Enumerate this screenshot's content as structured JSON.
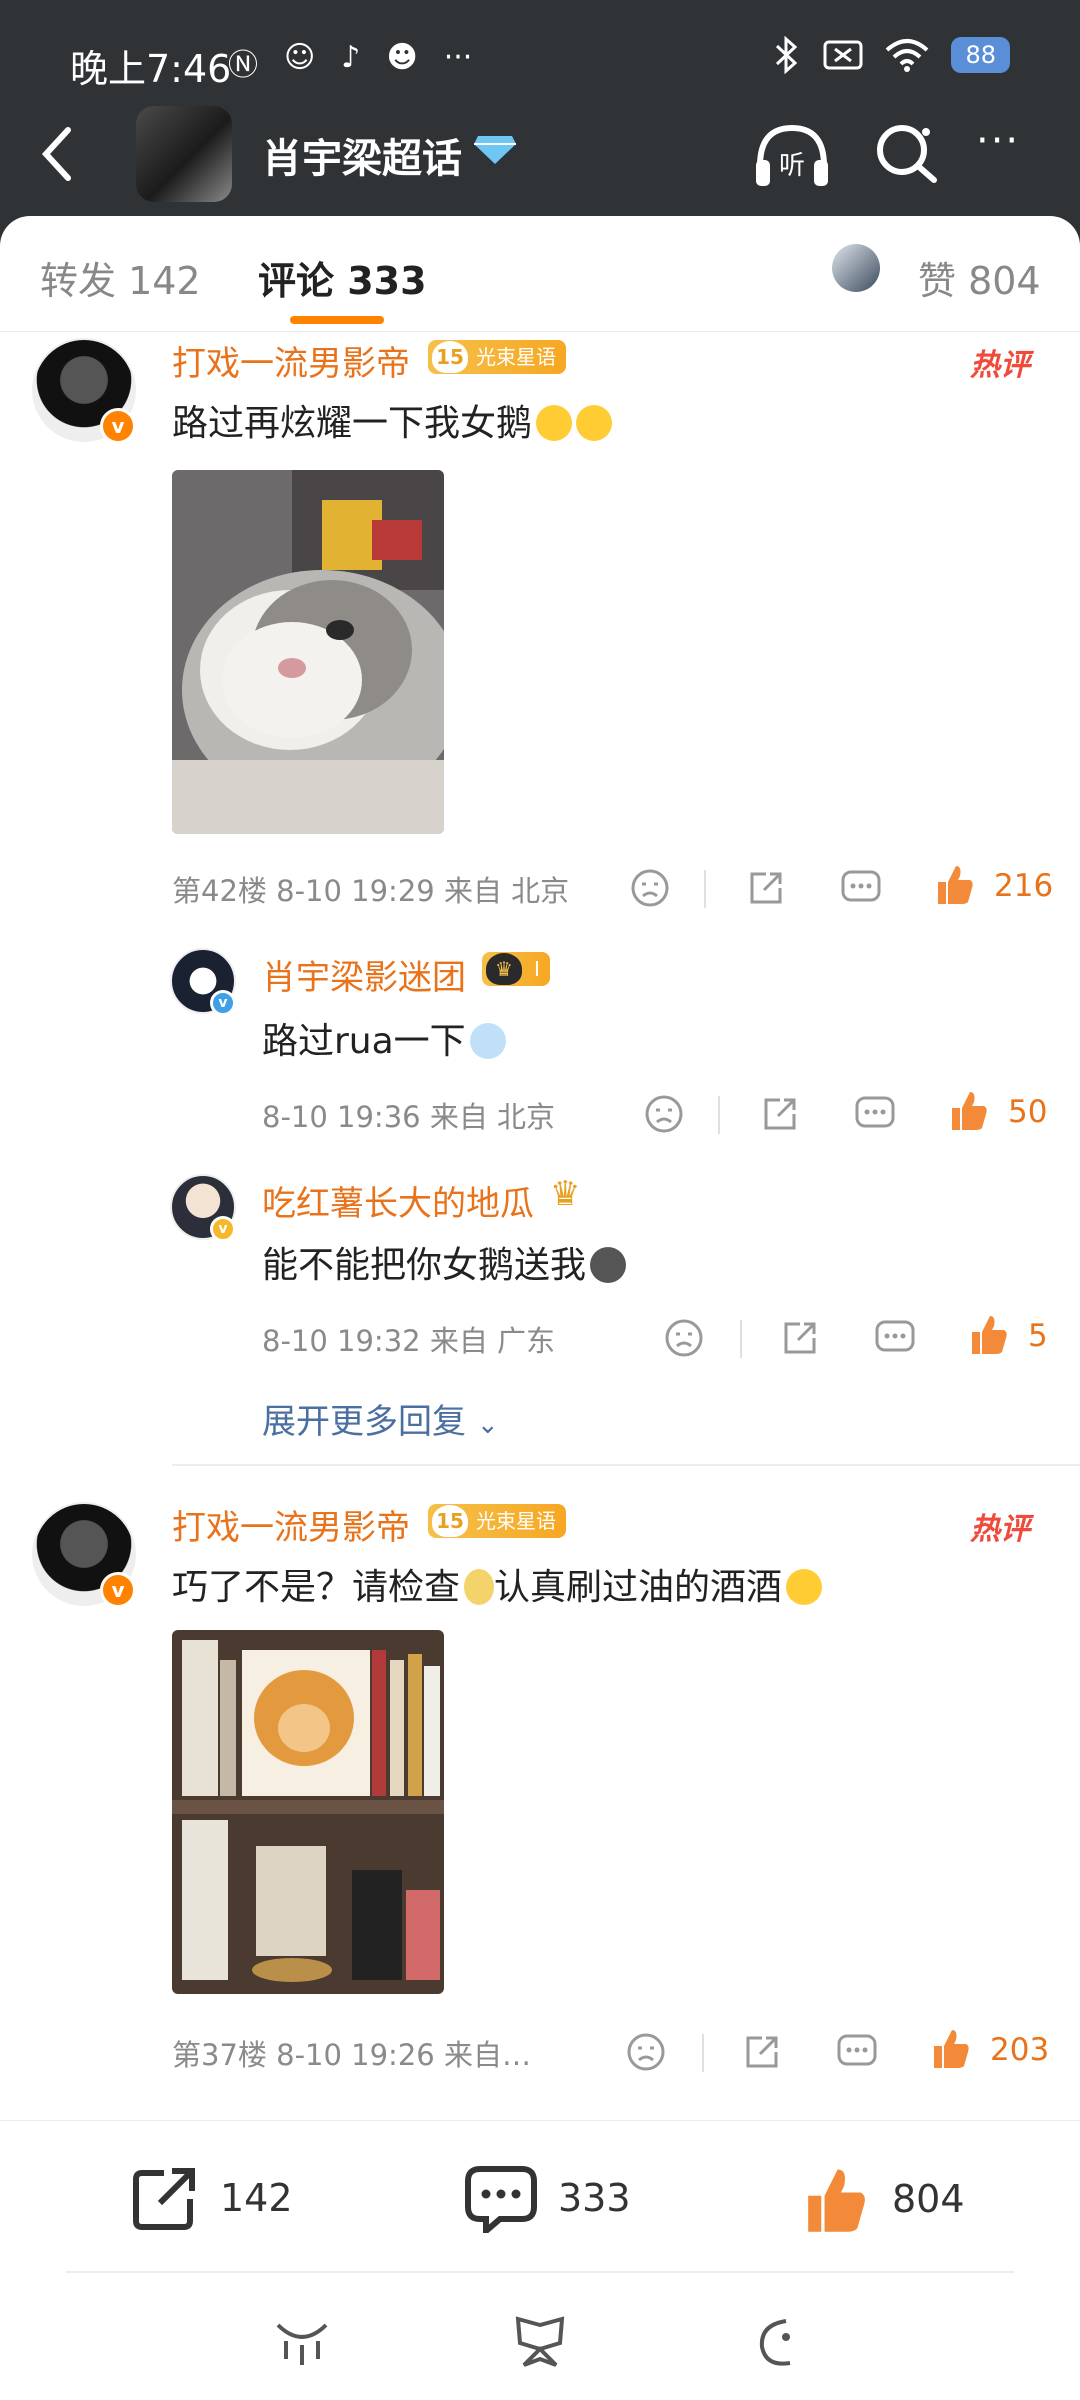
{
  "status_bar": {
    "time": "晚上7:46",
    "battery": "88"
  },
  "header": {
    "topic_title": "肖宇梁超话",
    "more_label": "···"
  },
  "tabs": {
    "repost": "转发 142",
    "comments": "评论 333",
    "likes": "赞 804"
  },
  "comments": [
    {
      "name": "打戏一流男影帝",
      "level": "15",
      "badge_text": "光束星语",
      "hot": "热评",
      "text": "路过再炫耀一下我女鹅",
      "meta": "第42楼  8-10 19:29  来自 北京",
      "likes": "216",
      "replies": [
        {
          "name": "肖宇梁影迷团",
          "badge_text": "I",
          "text": "路过rua一下",
          "meta": "8-10 19:36  来自 北京",
          "likes": "50"
        },
        {
          "name": "吃红薯长大的地瓜",
          "text": "能不能把你女鹅送我",
          "meta": "8-10 19:32  来自 广东",
          "likes": "5"
        }
      ],
      "expand": "展开更多回复"
    },
    {
      "name": "打戏一流男影帝",
      "level": "15",
      "badge_text": "光束星语",
      "hot": "热评",
      "text": "巧了不是？请检查",
      "text2": "认真刷过油的酒酒",
      "meta": "第37楼  8-10 19:26  来自…",
      "likes": "203"
    }
  ],
  "bottom_bar": {
    "repost_count": "142",
    "comment_count": "333",
    "like_count": "804"
  },
  "colors": {
    "accent": "#ff8200",
    "name": "#e8731b",
    "hot": "#ef4a3a",
    "header_bg": "#2f3336"
  }
}
